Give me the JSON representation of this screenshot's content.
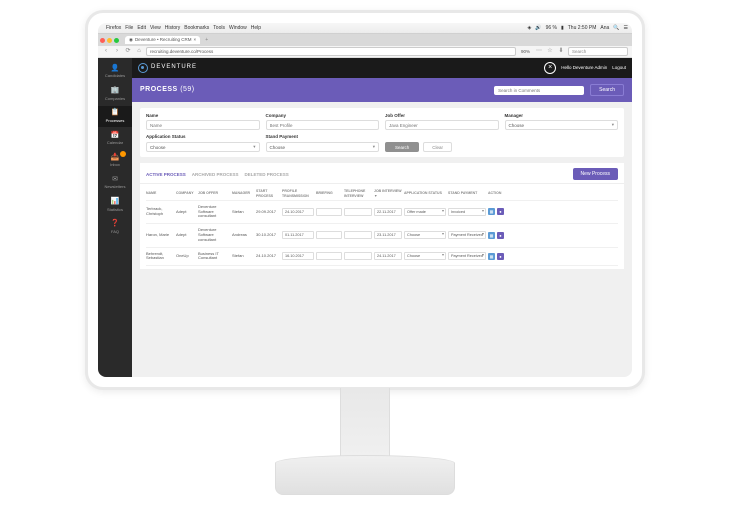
{
  "menubar": {
    "app": "Firefox",
    "items": [
      "File",
      "Edit",
      "View",
      "History",
      "Bookmarks",
      "Tools",
      "Window",
      "Help"
    ],
    "battery": "96 %",
    "time": "Thu 2:50 PM",
    "user": "Ana"
  },
  "browser": {
    "tab_title": "Deventure • Recruiting CRM",
    "url": "recruiting.deventure.co/Process",
    "zoom": "90%",
    "search_placeholder": "Search"
  },
  "sidebar": {
    "items": [
      {
        "icon": "👤",
        "label": "Candidates"
      },
      {
        "icon": "🏢",
        "label": "Companies"
      },
      {
        "icon": "📋",
        "label": "Processes"
      },
      {
        "icon": "📅",
        "label": "Calendar"
      },
      {
        "icon": "📥",
        "label": "Inbox"
      },
      {
        "icon": "✉",
        "label": "Newsletters"
      },
      {
        "icon": "📊",
        "label": "Statistics"
      },
      {
        "icon": "❓",
        "label": "FAQ"
      }
    ],
    "active_index": 2
  },
  "topbar": {
    "brand": "DEVENTURE",
    "greeting": "Hello Deventure Admin",
    "logout": "Logout"
  },
  "header": {
    "title": "PROCESS",
    "count": "(59)",
    "search_placeholder": "Search in Comments",
    "search_btn": "Search"
  },
  "filters": {
    "name": {
      "label": "Name",
      "placeholder": "Name"
    },
    "company": {
      "label": "Company",
      "placeholder": "Best Profile"
    },
    "job_offer": {
      "label": "Job Offer",
      "placeholder": "Java Engineer"
    },
    "manager": {
      "label": "Manager",
      "value": "Choose"
    },
    "app_status": {
      "label": "Application Status",
      "value": "Choose"
    },
    "stand_payment": {
      "label": "Stand Payment",
      "value": "Choose"
    },
    "search_btn": "Search",
    "clear_btn": "Clear"
  },
  "tabs": {
    "items": [
      "ACTIVE PROCESS",
      "ARCHIVED PROCESS",
      "DELETED PROCESS"
    ],
    "active_index": 0,
    "new_btn": "New Process"
  },
  "table": {
    "headers": [
      "NAME",
      "COMPANY",
      "JOB OFFER",
      "MANAGER",
      "START PROCESS",
      "PROFILE TRANSMISSION",
      "BRIEFING",
      "TELEPHONE INTERVIEW",
      "JOB INTERVIEW ▼",
      "APPLICATION STATUS",
      "STAND PAYMENT",
      "ACTION"
    ],
    "rows": [
      {
        "name": "Terbrack, Christoph",
        "company": "Adept",
        "job_offer": "Deventure Software consultant",
        "manager": "Stefan",
        "start": "29.09.2017",
        "profile": "24.10.2017",
        "briefing": "",
        "telephone": "",
        "job_interview": "22.11.2017",
        "app_status": "Offer made",
        "stand_payment": "Invoiced"
      },
      {
        "name": "Haron, Marie",
        "company": "Adept",
        "job_offer": "Deventure Software consultant",
        "manager": "Andreas",
        "start": "30.10.2017",
        "profile": "01.11.2017",
        "briefing": "",
        "telephone": "",
        "job_interview": "23.11.2017",
        "app_status": "Choose",
        "stand_payment": "Payment Received"
      },
      {
        "name": "Behrendt, Sebastian",
        "company": "OneUp",
        "job_offer": "Business IT Consultant",
        "manager": "Stefan",
        "start": "24.10.2017",
        "profile": "16.10.2017",
        "briefing": "",
        "telephone": "",
        "job_interview": "24.11.2017",
        "app_status": "Choose",
        "stand_payment": "Payment Received"
      }
    ]
  }
}
